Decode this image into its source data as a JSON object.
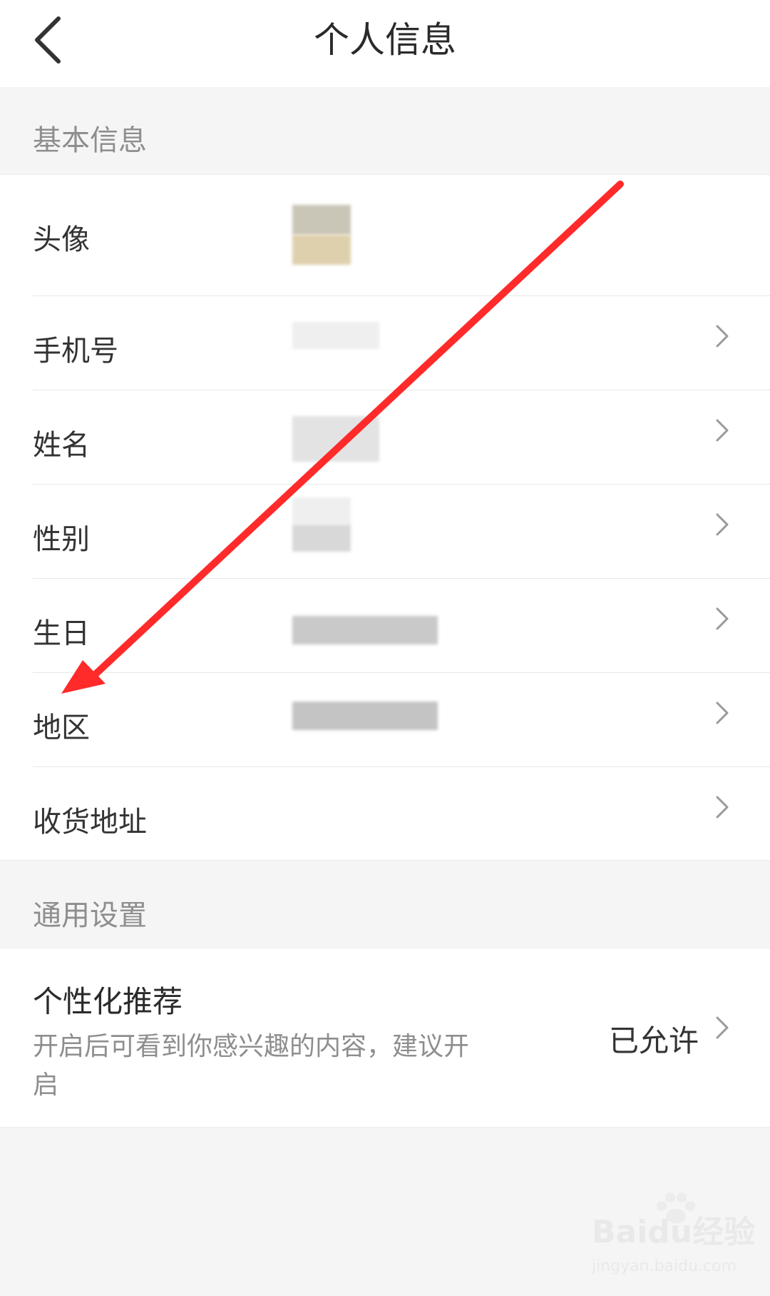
{
  "header": {
    "title": "个人信息",
    "back_icon": "chevron-left-icon"
  },
  "sections": {
    "basic": "基本信息",
    "general": "通用设置"
  },
  "basic_rows": {
    "avatar": "头像",
    "phone": "手机号",
    "name": "姓名",
    "gender": "性别",
    "birthday": "生日",
    "region": "地区",
    "address": "收货地址"
  },
  "recommend": {
    "title": "个性化推荐",
    "description": "开启后可看到你感兴趣的内容，建议开启",
    "status": "已允许"
  },
  "annotation": {
    "arrow_color": "#ff2a2a"
  },
  "watermark": {
    "brand": "Baidu经验",
    "url": "jingyan.baidu.com"
  },
  "colors": {
    "background": "#f5f5f5",
    "surface": "#ffffff",
    "muted_text": "#8e8e8e"
  }
}
